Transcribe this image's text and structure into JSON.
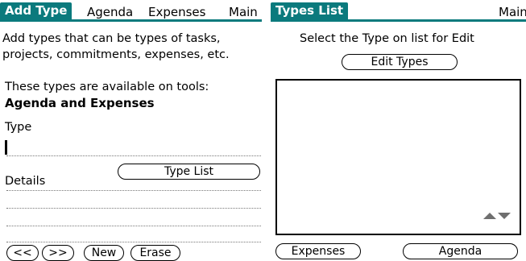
{
  "left_screen": {
    "title": "Add Type",
    "menu_items": [
      "Agenda",
      "Expenses",
      "Main"
    ],
    "description_line1": "Add types that can be types of tasks,",
    "description_line2": "projects, commitments, expenses, etc.",
    "available_line": "These types are available on tools:",
    "available_tools": "Agenda and Expenses",
    "type_label": "Type",
    "type_value": "",
    "details_label": "Details",
    "type_list_button": "Type List",
    "buttons": [
      "<<",
      ">>",
      "New",
      "Erase"
    ]
  },
  "right_screen": {
    "title": "Types List",
    "menu_item": "Main",
    "instruction": "Select the Type on list for Edit",
    "edit_button": "Edit Types",
    "list_items": [],
    "bottom_buttons": [
      "Expenses",
      "Agenda"
    ]
  },
  "colors": {
    "title_bar": "#0b7a7d",
    "scroll_arrows": "#6f6f6f"
  },
  "icons": [
    "scroll-up-arrow-icon",
    "scroll-down-arrow-icon"
  ]
}
